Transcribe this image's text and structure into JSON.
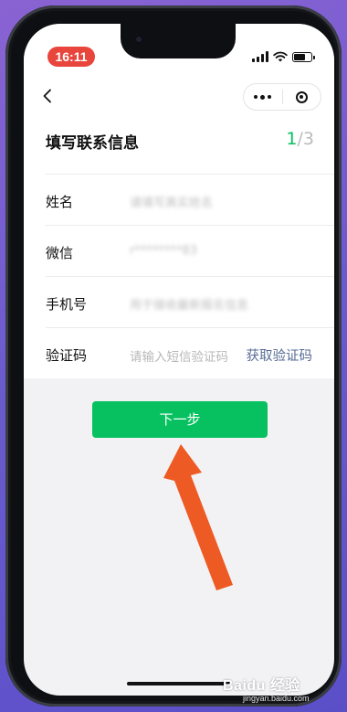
{
  "status_bar": {
    "time": "16:11"
  },
  "nav": {
    "back_icon": "chevron-left-icon",
    "more_icon": "more-dots-icon",
    "close_icon": "target-circle-icon"
  },
  "form": {
    "title": "填写联系信息",
    "step_current": "1",
    "step_total": "/3",
    "fields": [
      {
        "label": "姓名",
        "value": "请填写真实姓名"
      },
      {
        "label": "微信",
        "value": "r********83"
      },
      {
        "label": "手机号",
        "value": "用于接收最新报名信息"
      },
      {
        "label": "验证码",
        "placeholder": "请输入短信验证码",
        "action": "获取验证码"
      }
    ]
  },
  "next_button": {
    "label": "下一步"
  },
  "watermark": {
    "main": "Baidu 经验",
    "sub": "jingyan.baidu.com"
  },
  "colors": {
    "accent": "#07c160",
    "link": "#576b95",
    "arrow": "#ee5a24",
    "pill": "#e8453c"
  }
}
